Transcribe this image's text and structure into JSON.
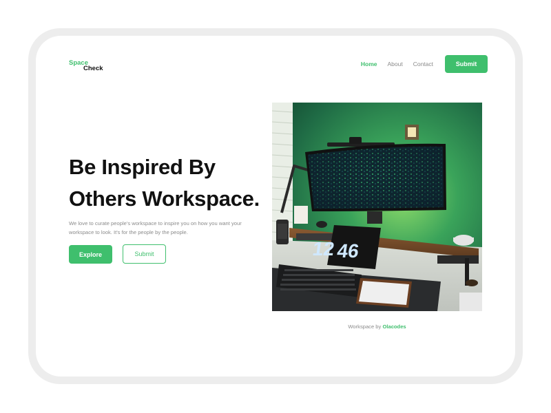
{
  "brand": {
    "word1": "Space",
    "word2": "Check"
  },
  "nav": {
    "items": [
      {
        "label": "Home",
        "active": true
      },
      {
        "label": "About",
        "active": false
      },
      {
        "label": "Contact",
        "active": false
      }
    ],
    "submit_label": "Submit"
  },
  "hero": {
    "title_line1": "Be Inspired By",
    "title_line2": "Others Workspace.",
    "description": "We love to curate people's workspace to inspire you on how you want your workspace to look. It's for the people by the people.",
    "explore_label": "Explore",
    "submit_label": "Submit"
  },
  "photo": {
    "clock_hours": "12",
    "clock_minutes": "46"
  },
  "caption": {
    "prefix": "Workspace by ",
    "author": "Olacodes"
  },
  "colors": {
    "accent": "#3fbf6d",
    "text": "#111111",
    "muted": "#8b8b8b",
    "frame": "#ededed"
  }
}
